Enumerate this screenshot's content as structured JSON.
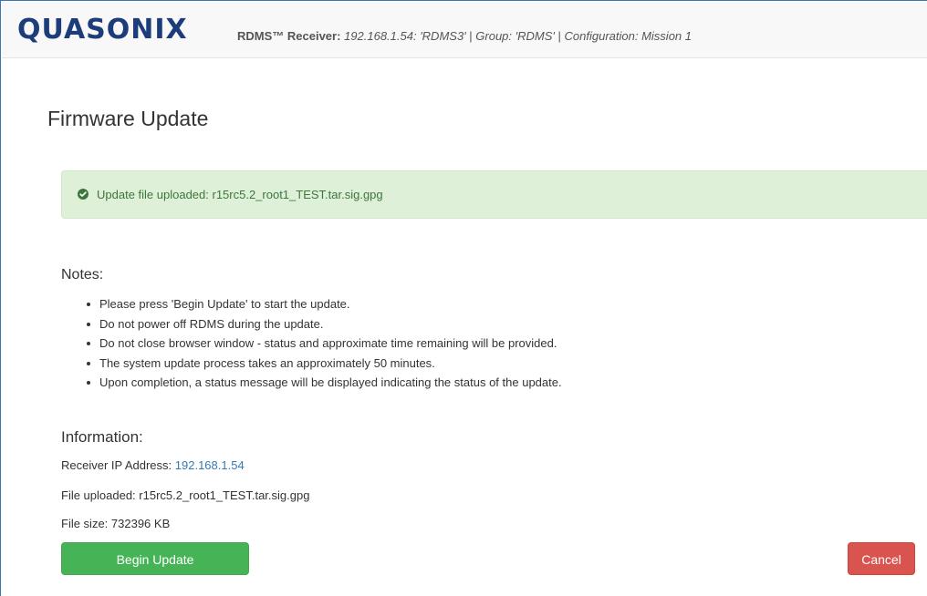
{
  "header": {
    "logo": "QUASONIX",
    "receiver_label": "RDMS™ Receiver:",
    "receiver_value": "192.168.1.54: 'RDMS3'",
    "group_label": "Group:",
    "group_value": "'RDMS'",
    "config_label": "Configuration:",
    "config_value": "Mission 1",
    "separator": " | "
  },
  "page": {
    "title": "Firmware Update"
  },
  "alert": {
    "icon": "check-circle-icon",
    "message": "Update file uploaded: r15rc5.2_root1_TEST.tar.sig.gpg",
    "color": "#3c763d",
    "background": "#dff0d8"
  },
  "notes": {
    "title": "Notes:",
    "items": [
      "Please press 'Begin Update' to start the update.",
      "Do not power off RDMS during the update.",
      "Do not close browser window - status and approximate time remaining will be provided.",
      "The system update process takes an approximately 50 minutes.",
      "Upon completion, a status message will be displayed indicating the status of the update."
    ]
  },
  "information": {
    "title": "Information:",
    "ip_label": "Receiver IP Address: ",
    "ip_value": "192.168.1.54",
    "file_label": "File uploaded: ",
    "file_value": "r15rc5.2_root1_TEST.tar.sig.gpg",
    "size_label": "File size: ",
    "size_value": "732396 KB"
  },
  "actions": {
    "begin_label": "Begin Update",
    "cancel_label": "Cancel",
    "begin_color": "#47b357",
    "cancel_color": "#d9534f"
  }
}
